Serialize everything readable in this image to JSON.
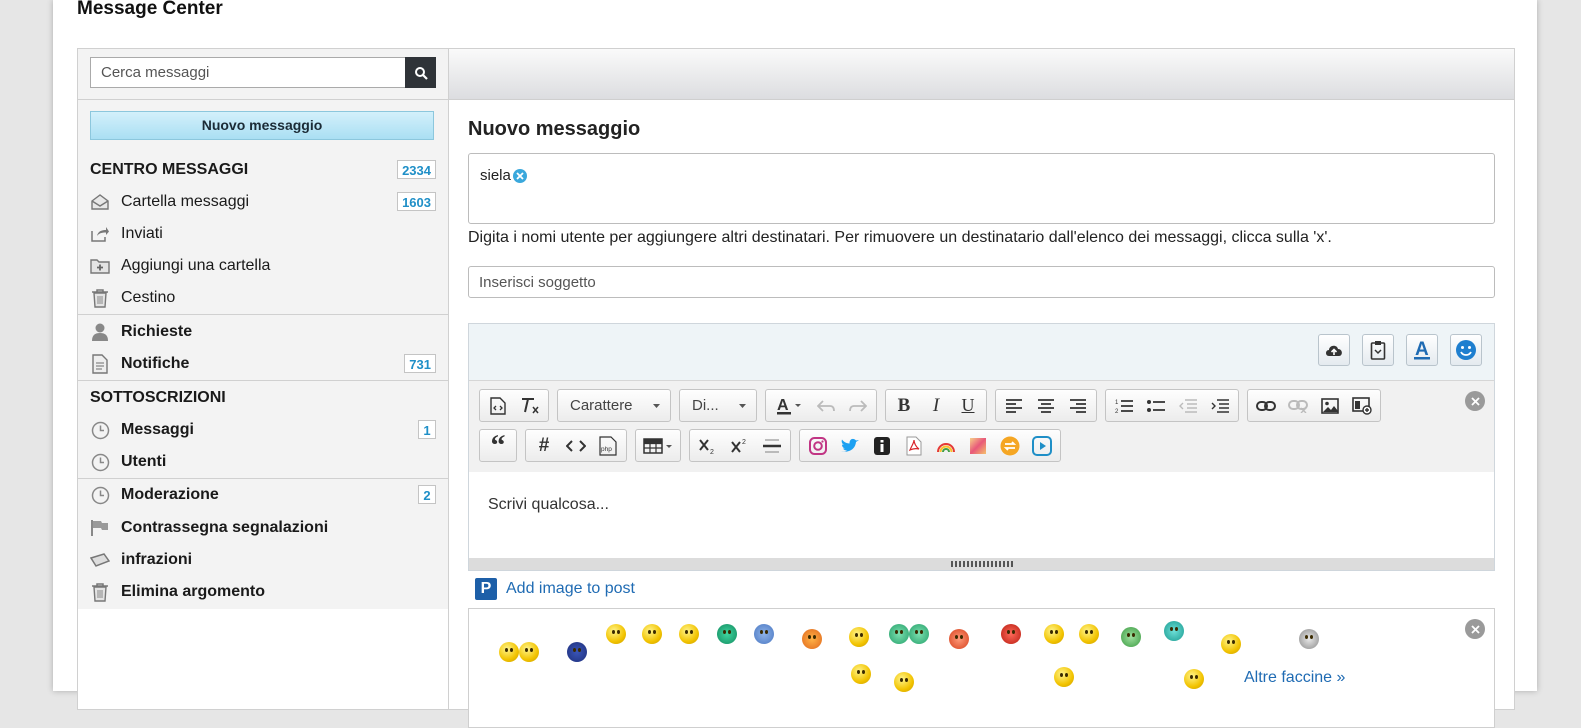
{
  "page": {
    "title": "Message Center"
  },
  "sidebar": {
    "search_placeholder": "Cerca messaggi",
    "new_message_label": "Nuovo messaggio",
    "inbox_header": {
      "label": "CENTRO MESSAGGI",
      "count": "2334"
    },
    "folders": [
      {
        "label": "Cartella messaggi",
        "icon": "envelope-open-icon",
        "count": "1603"
      },
      {
        "label": "Inviati",
        "icon": "share-icon",
        "count": ""
      },
      {
        "label": "Aggiungi una cartella",
        "icon": "folder-plus-icon",
        "count": ""
      },
      {
        "label": "Cestino",
        "icon": "trash-icon",
        "count": ""
      }
    ],
    "requests": {
      "label": "Richieste",
      "icon": "user-icon"
    },
    "notifications": {
      "label": "Notifiche",
      "icon": "document-icon",
      "count": "731"
    },
    "subscriptions_header": "SOTTOSCRIZIONI",
    "subscriptions": [
      {
        "label": "Messaggi",
        "icon": "clock-icon",
        "count": "1"
      },
      {
        "label": "Utenti",
        "icon": "clock-icon",
        "count": ""
      }
    ],
    "moderation": [
      {
        "label": "Moderazione",
        "icon": "clock-icon",
        "count": "2"
      },
      {
        "label": "Contrassegna segnalazioni",
        "icon": "flag-icon",
        "count": ""
      },
      {
        "label": "infrazioni",
        "icon": "tag-icon",
        "count": ""
      },
      {
        "label": "Elimina argomento",
        "icon": "trash-icon",
        "count": ""
      }
    ]
  },
  "compose": {
    "title": "Nuovo messaggio",
    "recipient": "siela",
    "hint": "Digita i nomi utente per aggiungere altri destinatari. Per rimuovere un destinatario dall'elenco dei messaggi, clicca sulla 'x'.",
    "subject_placeholder": "Inserisci soggetto",
    "font_combo": "Carattere",
    "size_combo": "Di...",
    "body_placeholder": "Scrivi qualcosa...",
    "add_image_label": "Add image to post",
    "more_smileys_label": "Altre faccine »"
  },
  "colors": {
    "accent": "#1f8fc7",
    "link": "#1f6bb3",
    "search_button": "#2f3338"
  }
}
